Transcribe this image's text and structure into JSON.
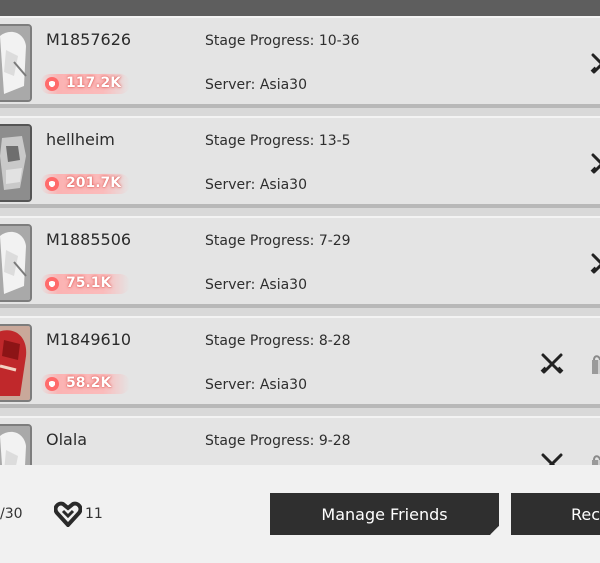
{
  "friends": [
    {
      "name": "M1857626",
      "power": "117.2K",
      "stage": "Stage Progress: 10-36",
      "server": "Server: Asia30",
      "avatar": "white-hair-character"
    },
    {
      "name": "hellheim",
      "power": "201.7K",
      "stage": "Stage Progress: 13-5",
      "server": "Server: Asia30",
      "avatar": "armored-character"
    },
    {
      "name": "M1885506",
      "power": "75.1K",
      "stage": "Stage Progress: 7-29",
      "server": "Server: Asia30",
      "avatar": "white-hair-character"
    },
    {
      "name": "M1849610",
      "power": "58.2K",
      "stage": "Stage Progress: 8-28",
      "server": "Server: Asia30",
      "avatar": "red-character"
    },
    {
      "name": "Olala",
      "stage": "Stage Progress: 9-28",
      "avatar": "white-hair-character"
    }
  ],
  "footer": {
    "friend_count": "/30",
    "heart_count": "11",
    "manage_label": "Manage Friends",
    "rec_label": "Rec"
  },
  "icons": {
    "power": "fist-icon",
    "battle": "crossed-swords-icon",
    "gift": "gift-icon",
    "heart": "heart-icon"
  },
  "colors": {
    "power_glow": "#e0554f",
    "button_bg": "#2f2f2f",
    "row_bg": "#e4e4e4"
  }
}
